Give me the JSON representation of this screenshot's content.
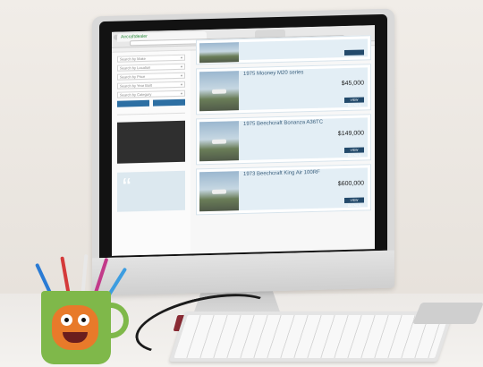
{
  "browser": {
    "tab_title": "Aircraftdealer",
    "tab2_title": ""
  },
  "sidebar": {
    "fields": [
      "Search by Make",
      "Search by Location",
      "Search by Price",
      "Search by Year Built",
      "Search by Category"
    ],
    "checks": "",
    "buttons": [
      "",
      ""
    ],
    "ad_text": "",
    "quote_text": ""
  },
  "listings": [
    {
      "title": "",
      "price": "",
      "button": ""
    },
    {
      "title": "1975 Mooney M20 series",
      "price": "$45,000",
      "button": "VIEW DETAILS"
    },
    {
      "title": "1975 Beechcraft Bonanza A36TC",
      "price": "$149,000",
      "button": "VIEW DETAILS"
    },
    {
      "title": "1973 Beechcraft King Air 100RF",
      "price": "$600,000",
      "button": "VIEW DETAILS"
    }
  ],
  "colors": {
    "accent": "#2d6fa3",
    "mug": "#7fb84a"
  },
  "icons": [
    "apple-logo-icon",
    "quote-icon"
  ]
}
